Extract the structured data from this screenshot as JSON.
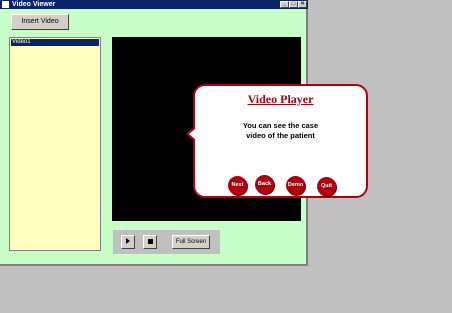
{
  "window": {
    "title": "Video Viewer"
  },
  "toolbar": {
    "insert_label": "Insert Video"
  },
  "playlist": {
    "items": [
      "Video1"
    ]
  },
  "controls": {
    "fullscreen_label": "Full Screen"
  },
  "callout": {
    "title": "Video Player",
    "body_line1": "You can see the case",
    "body_line2": "video of the patient",
    "buttons": {
      "next": "Next",
      "back": "Back",
      "demo": "Demo",
      "quit": "Quit"
    }
  },
  "colors": {
    "accent": "#b00010",
    "window_bg": "#c8ffc8",
    "list_bg": "#ffffc0",
    "video_bg": "#000000",
    "titlebar": "#0a246a"
  },
  "icons": [
    "app-icon",
    "minimize-icon",
    "maximize-icon",
    "close-icon",
    "play-icon",
    "stop-icon"
  ]
}
